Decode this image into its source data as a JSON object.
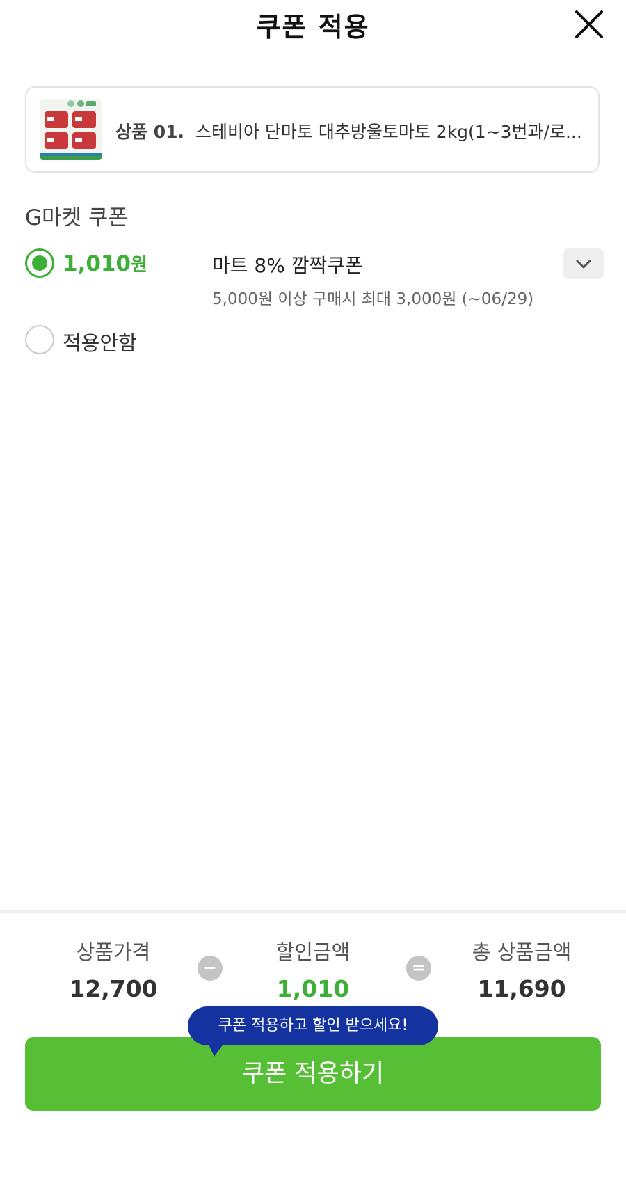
{
  "header": {
    "title": "쿠폰 적용"
  },
  "product": {
    "number": "상품 01.",
    "name": "스테비아 단마토 대추방울토마토 2kg(1~3번과/로..."
  },
  "coupon_section": {
    "title": "G마켓 쿠폰",
    "selected_coupon": {
      "amount": "1,010",
      "amount_unit": "원",
      "name": "마트 8% 깜짝쿠폰",
      "condition": "5,000원 이상 구매시 최대 3,000원 (~06/29)"
    },
    "none_label": "적용안함"
  },
  "summary": {
    "price_label": "상품가격",
    "price_value": "12,700",
    "discount_label": "할인금액",
    "discount_value": "1,010",
    "total_label": "총 상품금액",
    "total_value": "11,690",
    "minus": "−",
    "equals": "="
  },
  "tooltip": "쿠폰 적용하고 할인 받으세요!",
  "apply_button": "쿠폰 적용하기",
  "colors": {
    "accent_green": "#3cb035",
    "button_green": "#57bf35",
    "tooltip_blue": "#1432a0"
  }
}
